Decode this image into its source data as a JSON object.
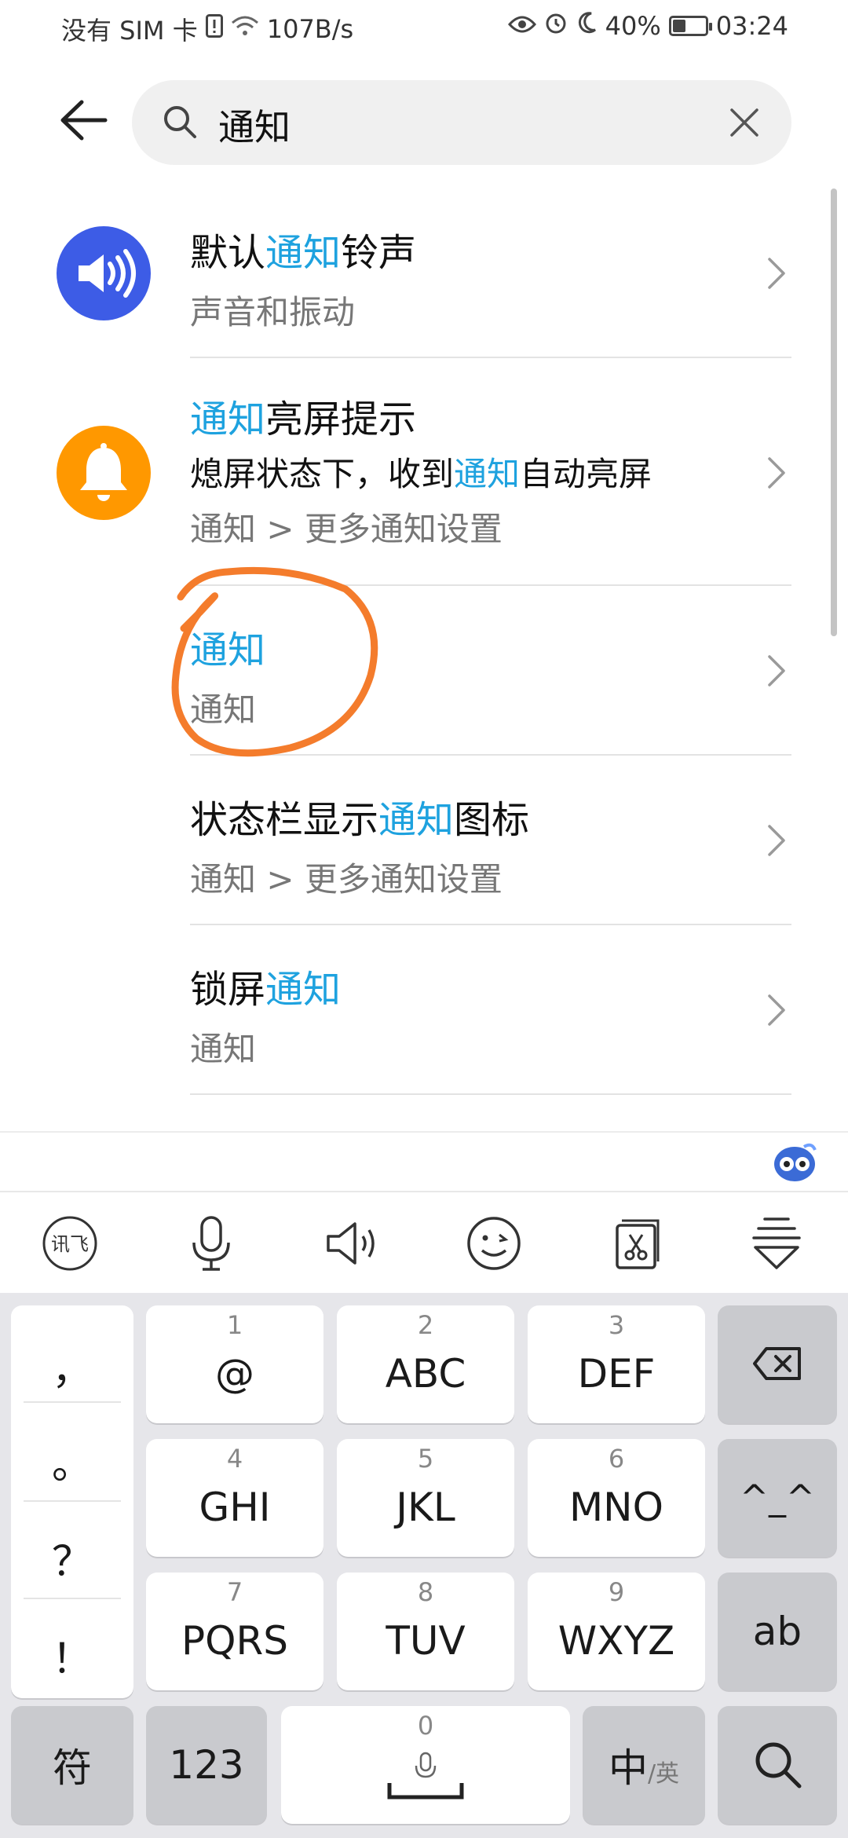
{
  "status_bar": {
    "carrier": "没有 SIM 卡",
    "speed": "107B/s",
    "battery_pct": "40%",
    "battery_level": 0.4,
    "time": "03:24"
  },
  "search": {
    "query": "通知"
  },
  "results": [
    {
      "title_parts": [
        "默认",
        "通知",
        "铃声"
      ],
      "subtitle": "声音和振动",
      "icon": "speaker-icon",
      "icon_color": "#3d5ce6"
    },
    {
      "title_parts": [
        "通知",
        "亮屏提示",
        ""
      ],
      "subtitle_parts": [
        "熄屏状态下，收到",
        "通知",
        "自动亮屏"
      ],
      "path": "通知 > 更多通知设置",
      "icon": "bell-icon",
      "icon_color": "#ff9800"
    },
    {
      "title_parts": [
        "",
        "通知",
        ""
      ],
      "subtitle": "通知"
    },
    {
      "title_parts": [
        "状态栏显示",
        "通知",
        "图标"
      ],
      "subtitle": "通知 > 更多通知设置"
    },
    {
      "title_parts": [
        "锁屏",
        "通知",
        ""
      ],
      "subtitle": "通知"
    }
  ],
  "colors": {
    "highlight": "#1ea2df",
    "annotation": "#f47c2c"
  },
  "keyboard": {
    "punctuation": [
      "，",
      "。",
      "？",
      "！"
    ],
    "keys": [
      {
        "num": "1",
        "label": "@"
      },
      {
        "num": "2",
        "label": "ABC"
      },
      {
        "num": "3",
        "label": "DEF"
      },
      {
        "num": "4",
        "label": "GHI"
      },
      {
        "num": "5",
        "label": "JKL"
      },
      {
        "num": "6",
        "label": "MNO"
      },
      {
        "num": "7",
        "label": "PQRS"
      },
      {
        "num": "8",
        "label": "TUV"
      },
      {
        "num": "9",
        "label": "WXYZ"
      }
    ],
    "emoticon": "^_^",
    "ab": "ab",
    "symbols": "符",
    "numbers": "123",
    "space_num": "0",
    "lang_main": "中",
    "lang_alt": "/英"
  }
}
